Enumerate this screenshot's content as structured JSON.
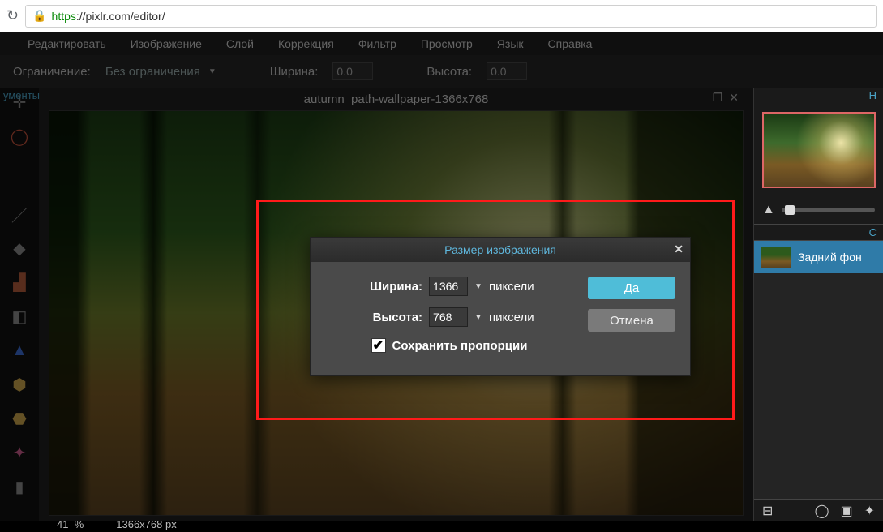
{
  "browser": {
    "url_proto": "https",
    "url_rest": "://pixlr.com/editor/"
  },
  "menu": {
    "edit": "Редактировать",
    "image": "Изображение",
    "layer": "Слой",
    "correction": "Коррекция",
    "filter": "Фильтр",
    "view": "Просмотр",
    "language": "Язык",
    "help": "Справка"
  },
  "options": {
    "constraint_label": "Ограничение:",
    "constraint_value": "Без ограничения",
    "width_label": "Ширина:",
    "width_value": "0.0",
    "height_label": "Высота:",
    "height_value": "0.0"
  },
  "tools_label": "ументы",
  "document": {
    "title": "autumn_path-wallpaper-1366x768"
  },
  "status": {
    "zoom": "41",
    "zoom_unit": "%",
    "dims": "1366x768 px"
  },
  "layers": {
    "head": "Н",
    "head2": "С",
    "background": "Задний фон"
  },
  "dialog": {
    "title": "Размер изображения",
    "width_label": "Ширина:",
    "width_value": "1366",
    "width_unit": "пиксели",
    "height_label": "Высота:",
    "height_value": "768",
    "height_unit": "пиксели",
    "keep": "Сохранить пропорции",
    "ok": "Да",
    "cancel": "Отмена"
  }
}
